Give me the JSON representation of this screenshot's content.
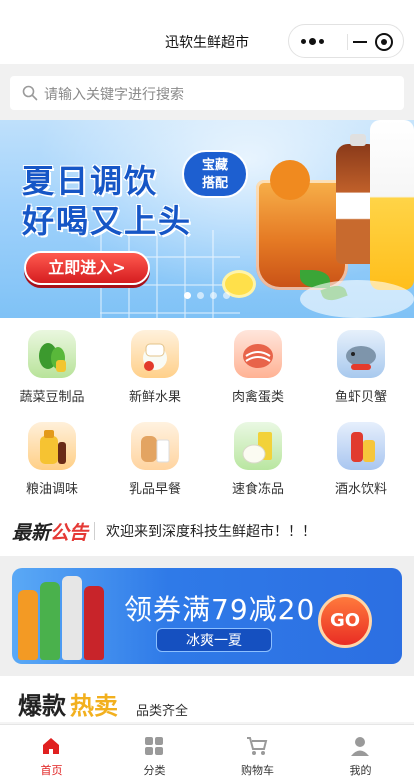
{
  "navbar": {
    "title": "迅软生鲜超市"
  },
  "search": {
    "placeholder": "请输入关键字进行搜索"
  },
  "banner": {
    "headline_1": "夏日调饮",
    "headline_2": "好喝又上头",
    "badge_1": "宝藏",
    "badge_2": "搭配",
    "cta": "立即进入>",
    "slide_count": 4,
    "active_slide": 1
  },
  "categories": [
    {
      "label": "蔬菜豆制品",
      "icon": "vegetable-icon"
    },
    {
      "label": "新鲜水果",
      "icon": "fruit-icon"
    },
    {
      "label": "肉禽蛋类",
      "icon": "meat-icon"
    },
    {
      "label": "鱼虾贝蟹",
      "icon": "seafood-icon"
    },
    {
      "label": "粮油调味",
      "icon": "grain-oil-icon"
    },
    {
      "label": "乳品早餐",
      "icon": "dairy-icon"
    },
    {
      "label": "速食冻品",
      "icon": "frozen-food-icon"
    },
    {
      "label": "酒水饮料",
      "icon": "drinks-icon"
    }
  ],
  "notice": {
    "logo_a": "最新",
    "logo_b": "公告",
    "text": "欢迎来到深度科技生鲜超市！！！"
  },
  "coupon": {
    "title": "领券满79减20",
    "subtitle": "冰爽一夏",
    "go": "GO"
  },
  "hot": {
    "title_a": "爆款",
    "title_b": "热卖",
    "subtitle": "品类齐全"
  },
  "tabbar": [
    {
      "label": "首页",
      "icon": "home-icon",
      "active": true
    },
    {
      "label": "分类",
      "icon": "category-icon",
      "active": false
    },
    {
      "label": "购物车",
      "icon": "cart-icon",
      "active": false
    },
    {
      "label": "我的",
      "icon": "user-icon",
      "active": false
    }
  ],
  "colors": {
    "accent": "#e02020",
    "banner_blue": "#1656c6",
    "hot_yellow": "#f2b01e"
  }
}
